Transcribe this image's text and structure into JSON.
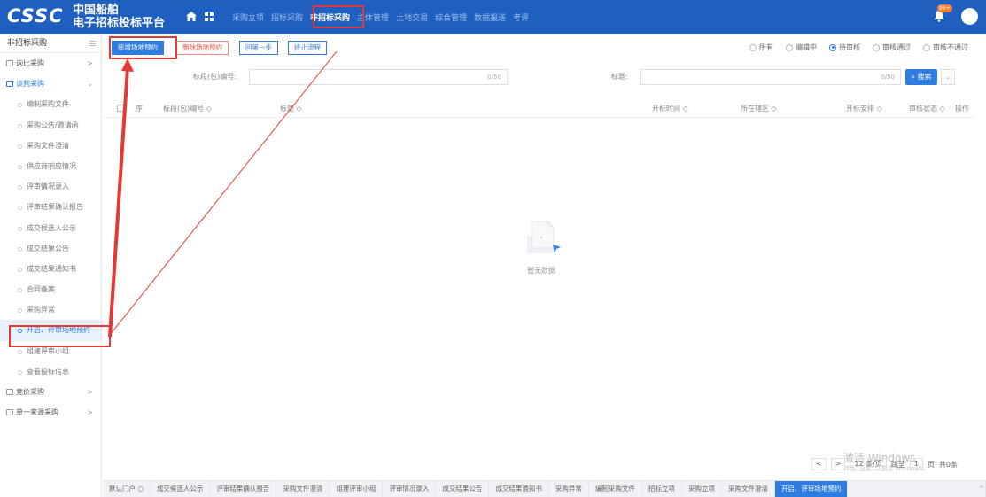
{
  "header": {
    "logo": "CSSC",
    "brand_line1": "中国船舶",
    "brand_line2": "电子招标投标平台",
    "nav": [
      "采购立项",
      "招标采购",
      "非招标采购",
      "主体管理",
      "土地交易",
      "综合管理",
      "数据报送",
      "考评"
    ],
    "active_nav": "非招标采购",
    "notification_badge": "99+"
  },
  "sidebar": {
    "title": "非招标采购",
    "items": [
      {
        "label": "询比采购",
        "type": "top"
      },
      {
        "label": "谈判采购",
        "type": "top",
        "open": true
      },
      {
        "label": "编制采购文件",
        "type": "sub"
      },
      {
        "label": "采购公告/邀请函",
        "type": "sub"
      },
      {
        "label": "采购文件澄清",
        "type": "sub"
      },
      {
        "label": "供应商响应情况",
        "type": "sub"
      },
      {
        "label": "评审情况录入",
        "type": "sub"
      },
      {
        "label": "评审结果确认报告",
        "type": "sub"
      },
      {
        "label": "成交候选人公示",
        "type": "sub"
      },
      {
        "label": "成交结果公告",
        "type": "sub"
      },
      {
        "label": "成交结果通知书",
        "type": "sub"
      },
      {
        "label": "合同备案",
        "type": "sub"
      },
      {
        "label": "采购异常",
        "type": "sub"
      },
      {
        "label": "开启、评审场地预约",
        "type": "sub",
        "active": true
      },
      {
        "label": "组建评审小组",
        "type": "sub"
      },
      {
        "label": "查看投标信息",
        "type": "sub"
      },
      {
        "label": "竞价采购",
        "type": "top"
      },
      {
        "label": "单一来源采购",
        "type": "top"
      }
    ]
  },
  "toolbar": {
    "add": "新增场地预约",
    "delete": "删除场地预约",
    "back": "回第一步",
    "stop": "终止流程"
  },
  "filters": {
    "options": [
      "所有",
      "编辑中",
      "待审核",
      "审核通过",
      "审核不通过"
    ],
    "selected": "待审核"
  },
  "search": {
    "code_label": "标段(包)编号:",
    "code_counter": "0/50",
    "title_label": "标题:",
    "title_counter": "0/50",
    "button": "搜索"
  },
  "table": {
    "columns": [
      "序",
      "标段(包)编号 ◇",
      "标题 ◇",
      "开标时间 ◇",
      "所在辖区 ◇",
      "开标安排 ◇",
      "审核状态 ◇",
      "操作"
    ],
    "empty_text": "暂无数据"
  },
  "pagination": {
    "page_size": "12 条/页",
    "jump_label": "跳至",
    "page": "1",
    "page_unit": "页",
    "total": "共0条"
  },
  "watermark": {
    "line1": "激活 Windows",
    "line2": "转到“设置”以激活 Windows。"
  },
  "tabs": [
    "默认门户",
    "成交候选人公示",
    "评审结果确认报告",
    "采购文件澄清",
    "组建评审小组",
    "评审情况录入",
    "成交结果公告",
    "成交结果通知书",
    "采购异常",
    "编制采购文件",
    "招标立项",
    "采购立项",
    "采购文件澄清",
    "开启、评审场地预约"
  ],
  "active_tab": "开启、评审场地预约",
  "colors": {
    "primary": "#2f7ce0",
    "header": "#1f5fbf",
    "annotation": "#e53935"
  }
}
